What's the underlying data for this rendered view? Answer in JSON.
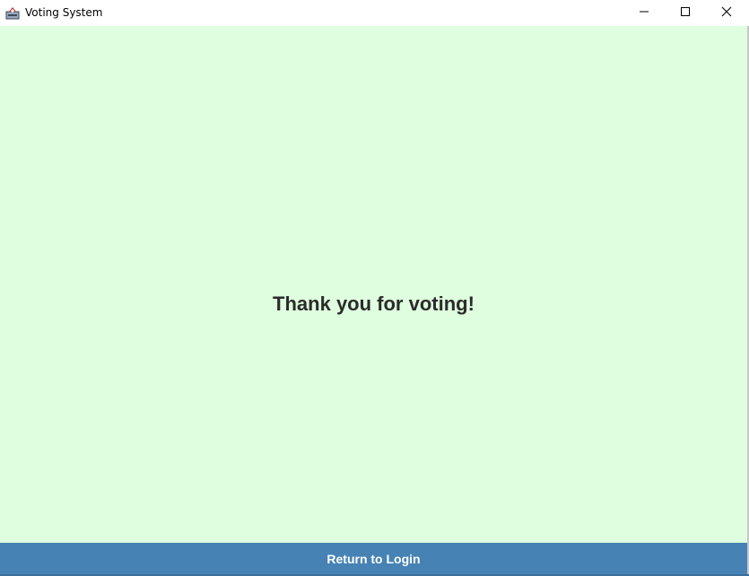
{
  "window": {
    "title": "Voting System",
    "app_icon": "java-app-icon",
    "controls": {
      "minimize_icon": "minimize-icon",
      "maximize_icon": "maximize-icon",
      "close_icon": "close-icon"
    }
  },
  "main": {
    "message": "Thank you for voting!"
  },
  "footer": {
    "return_label": "Return to Login"
  },
  "colors": {
    "background": "#dffedf",
    "button": "#4682b4",
    "button_text": "#ffffff",
    "message_text": "#2b2b2b"
  }
}
